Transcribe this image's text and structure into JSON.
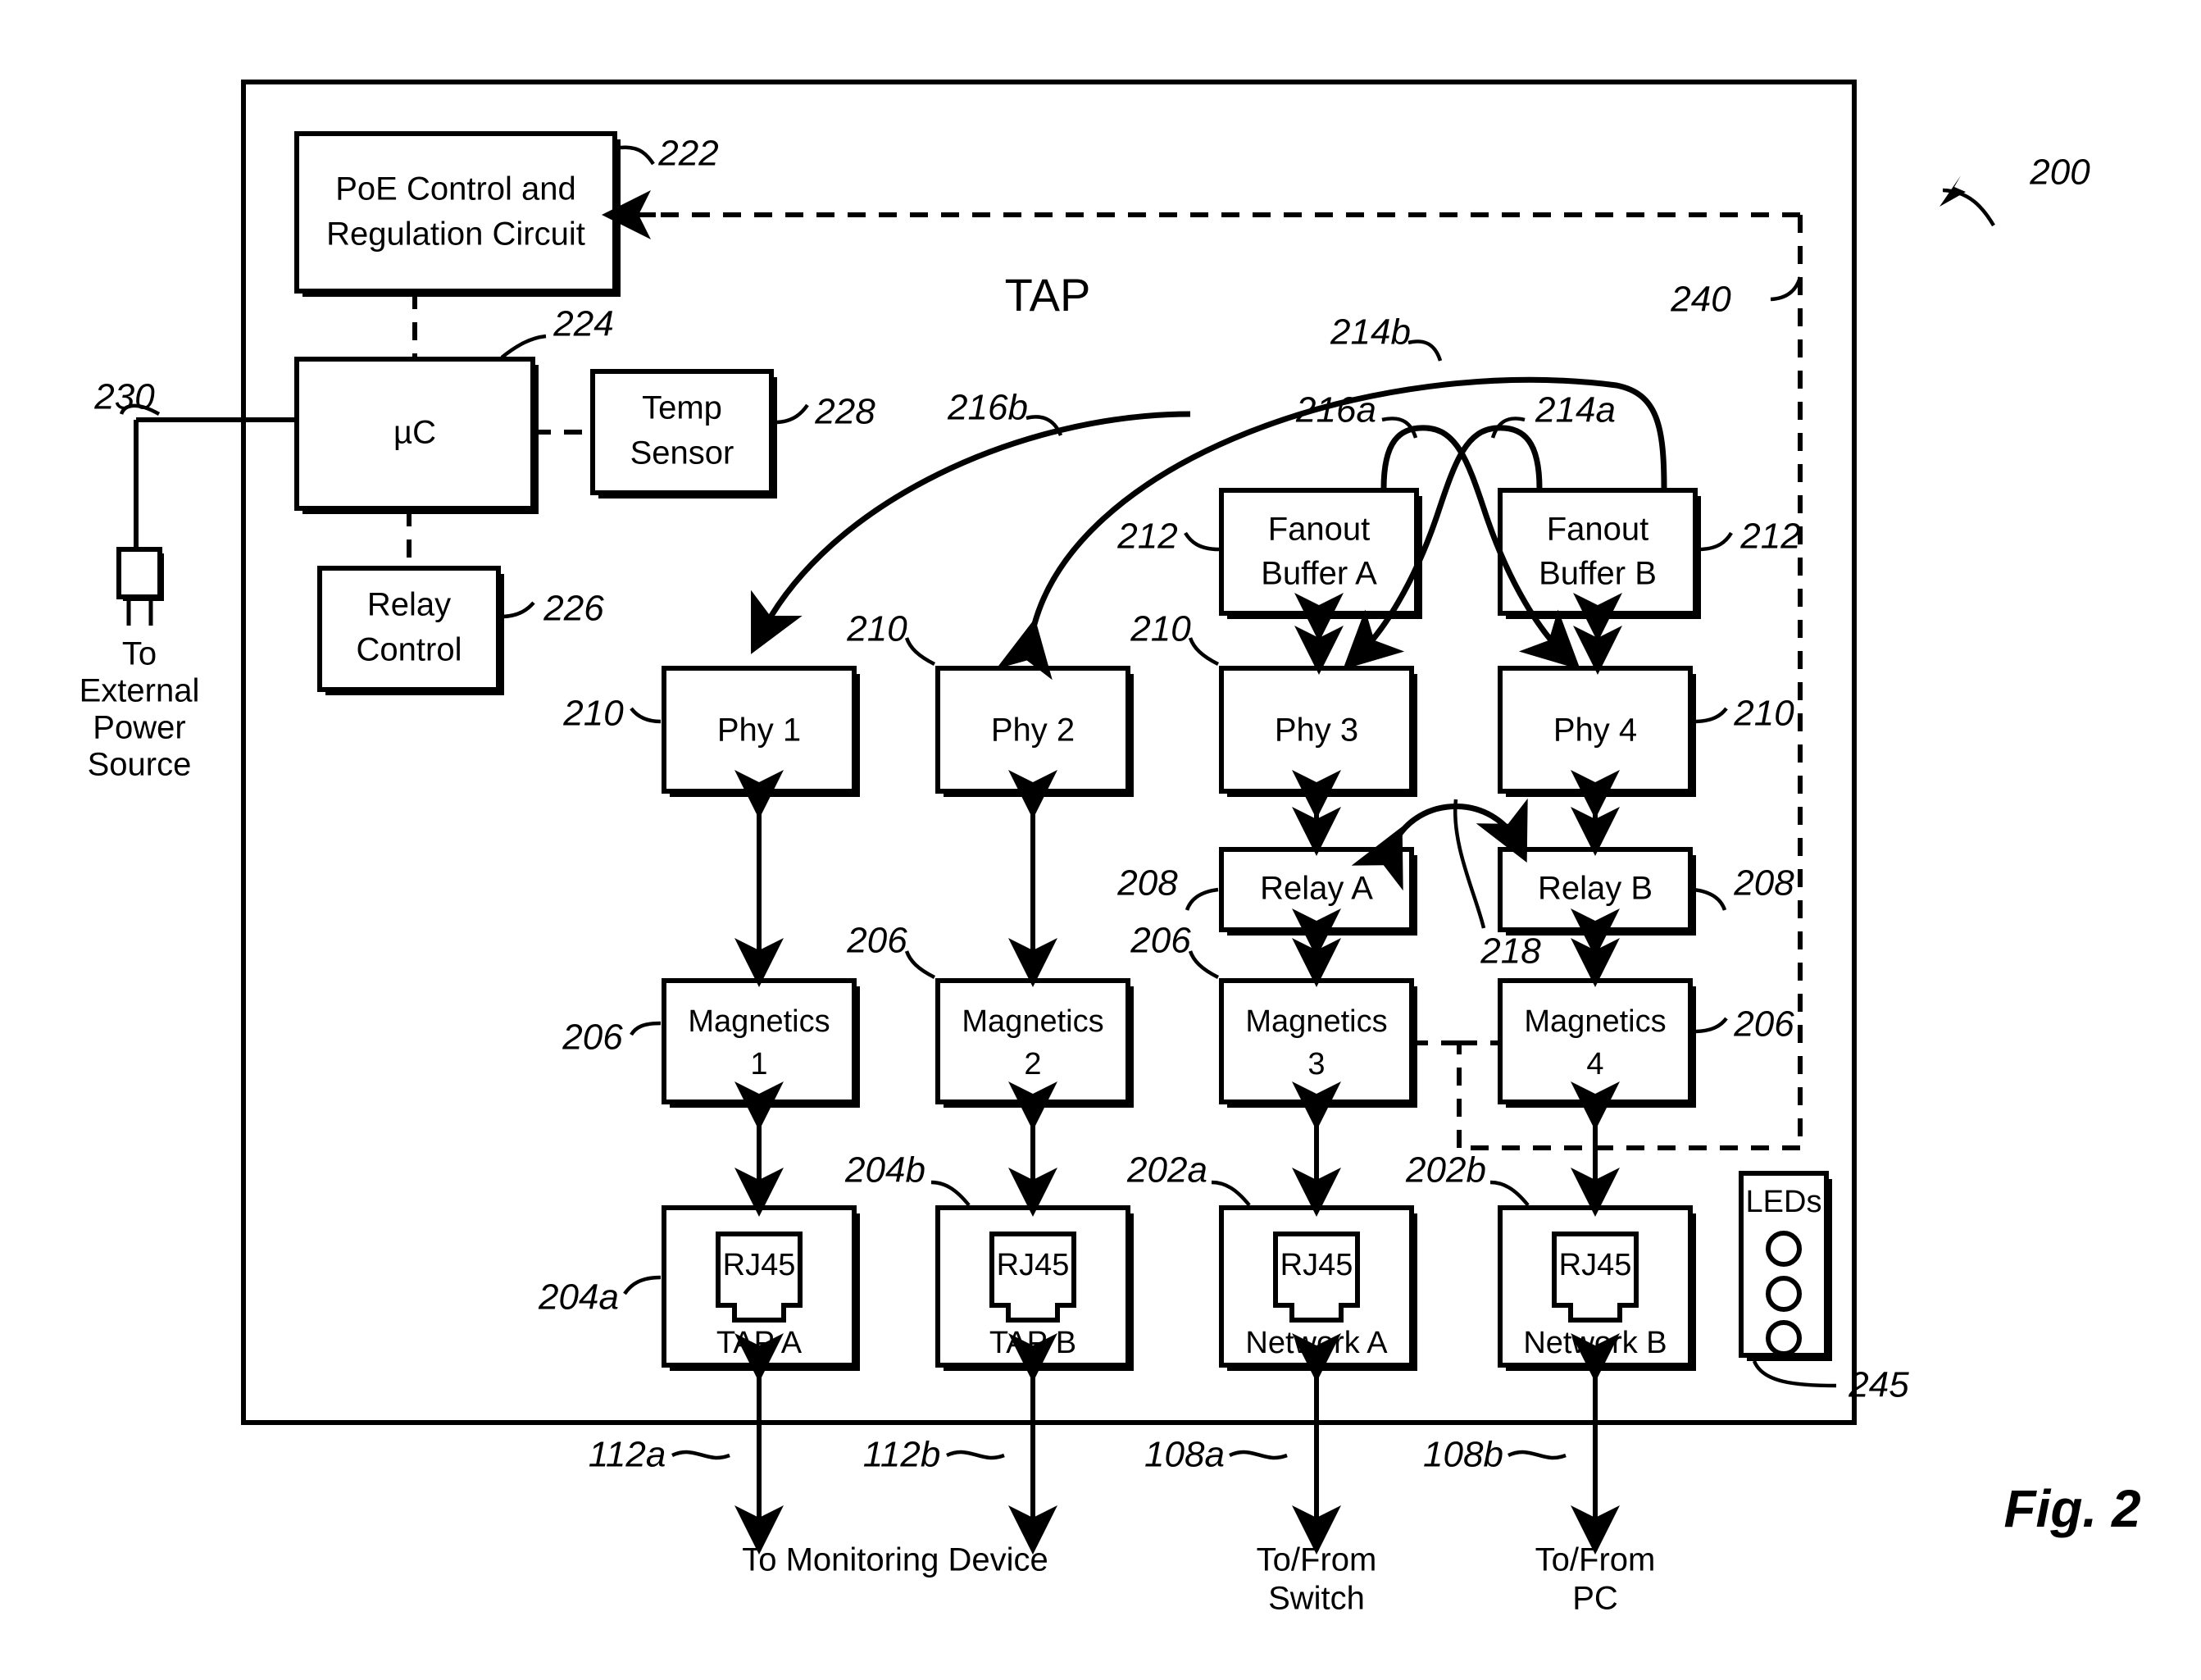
{
  "figure": {
    "label": "Fig. 2",
    "system_ref": "200",
    "title": "TAP"
  },
  "blocks": {
    "poe": {
      "line1": "PoE Control and",
      "line2": "Regulation Circuit",
      "ref": "222"
    },
    "uc": {
      "label": "µC",
      "ref": "224"
    },
    "temp": {
      "line1": "Temp",
      "line2": "Sensor",
      "ref": "228"
    },
    "relay_control": {
      "line1": "Relay",
      "line2": "Control",
      "ref": "226"
    },
    "power_line_ref": "230",
    "external_power": {
      "line1": "To",
      "line2": "External",
      "line3": "Power",
      "line4": "Source"
    },
    "fanout_a": {
      "line1": "Fanout",
      "line2": "Buffer A",
      "ref": "212"
    },
    "fanout_b": {
      "line1": "Fanout",
      "line2": "Buffer B",
      "ref": "212"
    },
    "phy1": {
      "label": "Phy 1",
      "ref": "210"
    },
    "phy2": {
      "label": "Phy 2",
      "ref": "210"
    },
    "phy3": {
      "label": "Phy 3",
      "ref": "210"
    },
    "phy4": {
      "label": "Phy 4",
      "ref": "210"
    },
    "relay_a": {
      "label": "Relay A",
      "ref": "208"
    },
    "relay_b": {
      "label": "Relay B",
      "ref": "208"
    },
    "magnetics1": {
      "line1": "Magnetics",
      "line2": "1",
      "ref": "206"
    },
    "magnetics2": {
      "line1": "Magnetics",
      "line2": "2",
      "ref": "206"
    },
    "magnetics3": {
      "line1": "Magnetics",
      "line2": "3",
      "ref": "206"
    },
    "magnetics4": {
      "line1": "Magnetics",
      "line2": "4",
      "ref": "206"
    },
    "port_tap_a": {
      "connector": "RJ45",
      "label": "TAP A",
      "ref": "204a"
    },
    "port_tap_b": {
      "connector": "RJ45",
      "label": "TAP B",
      "ref": "204b"
    },
    "port_network_a": {
      "connector": "RJ45",
      "label": "Network A",
      "ref": "202a"
    },
    "port_network_b": {
      "connector": "RJ45",
      "label": "Network B",
      "ref": "202b"
    },
    "leds": {
      "label": "LEDs",
      "ref": "245",
      "count": 3
    }
  },
  "refs": {
    "crossover_214a": "214a",
    "crossover_214b": "214b",
    "crossover_216a": "216a",
    "crossover_216b": "216b",
    "relay_link_218": "218",
    "poe_feedback_240": "240"
  },
  "external_links": [
    {
      "ref": "112a",
      "label_line1": "To Monitoring Device",
      "label_line2": ""
    },
    {
      "ref": "112b",
      "label_line1": "",
      "label_line2": ""
    },
    {
      "ref": "108a",
      "label_line1": "To/From",
      "label_line2": "Switch"
    },
    {
      "ref": "108b",
      "label_line1": "To/From",
      "label_line2": "PC"
    }
  ],
  "external_labels": {
    "monitoring": "To Monitoring Device",
    "switch_l1": "To/From",
    "switch_l2": "Switch",
    "pc_l1": "To/From",
    "pc_l2": "PC"
  },
  "colors": {
    "ink": "#000000",
    "paper": "#ffffff"
  }
}
